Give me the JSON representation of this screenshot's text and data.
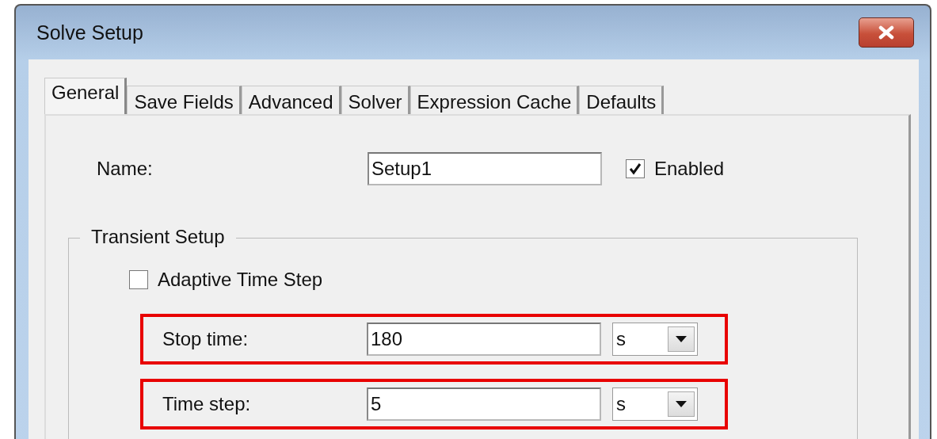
{
  "window": {
    "title": "Solve Setup"
  },
  "tabs": [
    {
      "label": "General",
      "selected": true
    },
    {
      "label": "Save Fields",
      "selected": false
    },
    {
      "label": "Advanced",
      "selected": false
    },
    {
      "label": "Solver",
      "selected": false
    },
    {
      "label": "Expression Cache",
      "selected": false
    },
    {
      "label": "Defaults",
      "selected": false
    }
  ],
  "name_field": {
    "label": "Name:",
    "value": "Setup1"
  },
  "enabled": {
    "label": "Enabled",
    "checked": true
  },
  "transient_setup": {
    "title": "Transient Setup",
    "adaptive_time_step": {
      "label": "Adaptive Time Step",
      "checked": false
    },
    "rows": [
      {
        "label": "Stop time:",
        "value": "180",
        "unit": "s",
        "highlighted": true
      },
      {
        "label": "Time step:",
        "value": "5",
        "unit": "s",
        "highlighted": true
      }
    ]
  }
}
